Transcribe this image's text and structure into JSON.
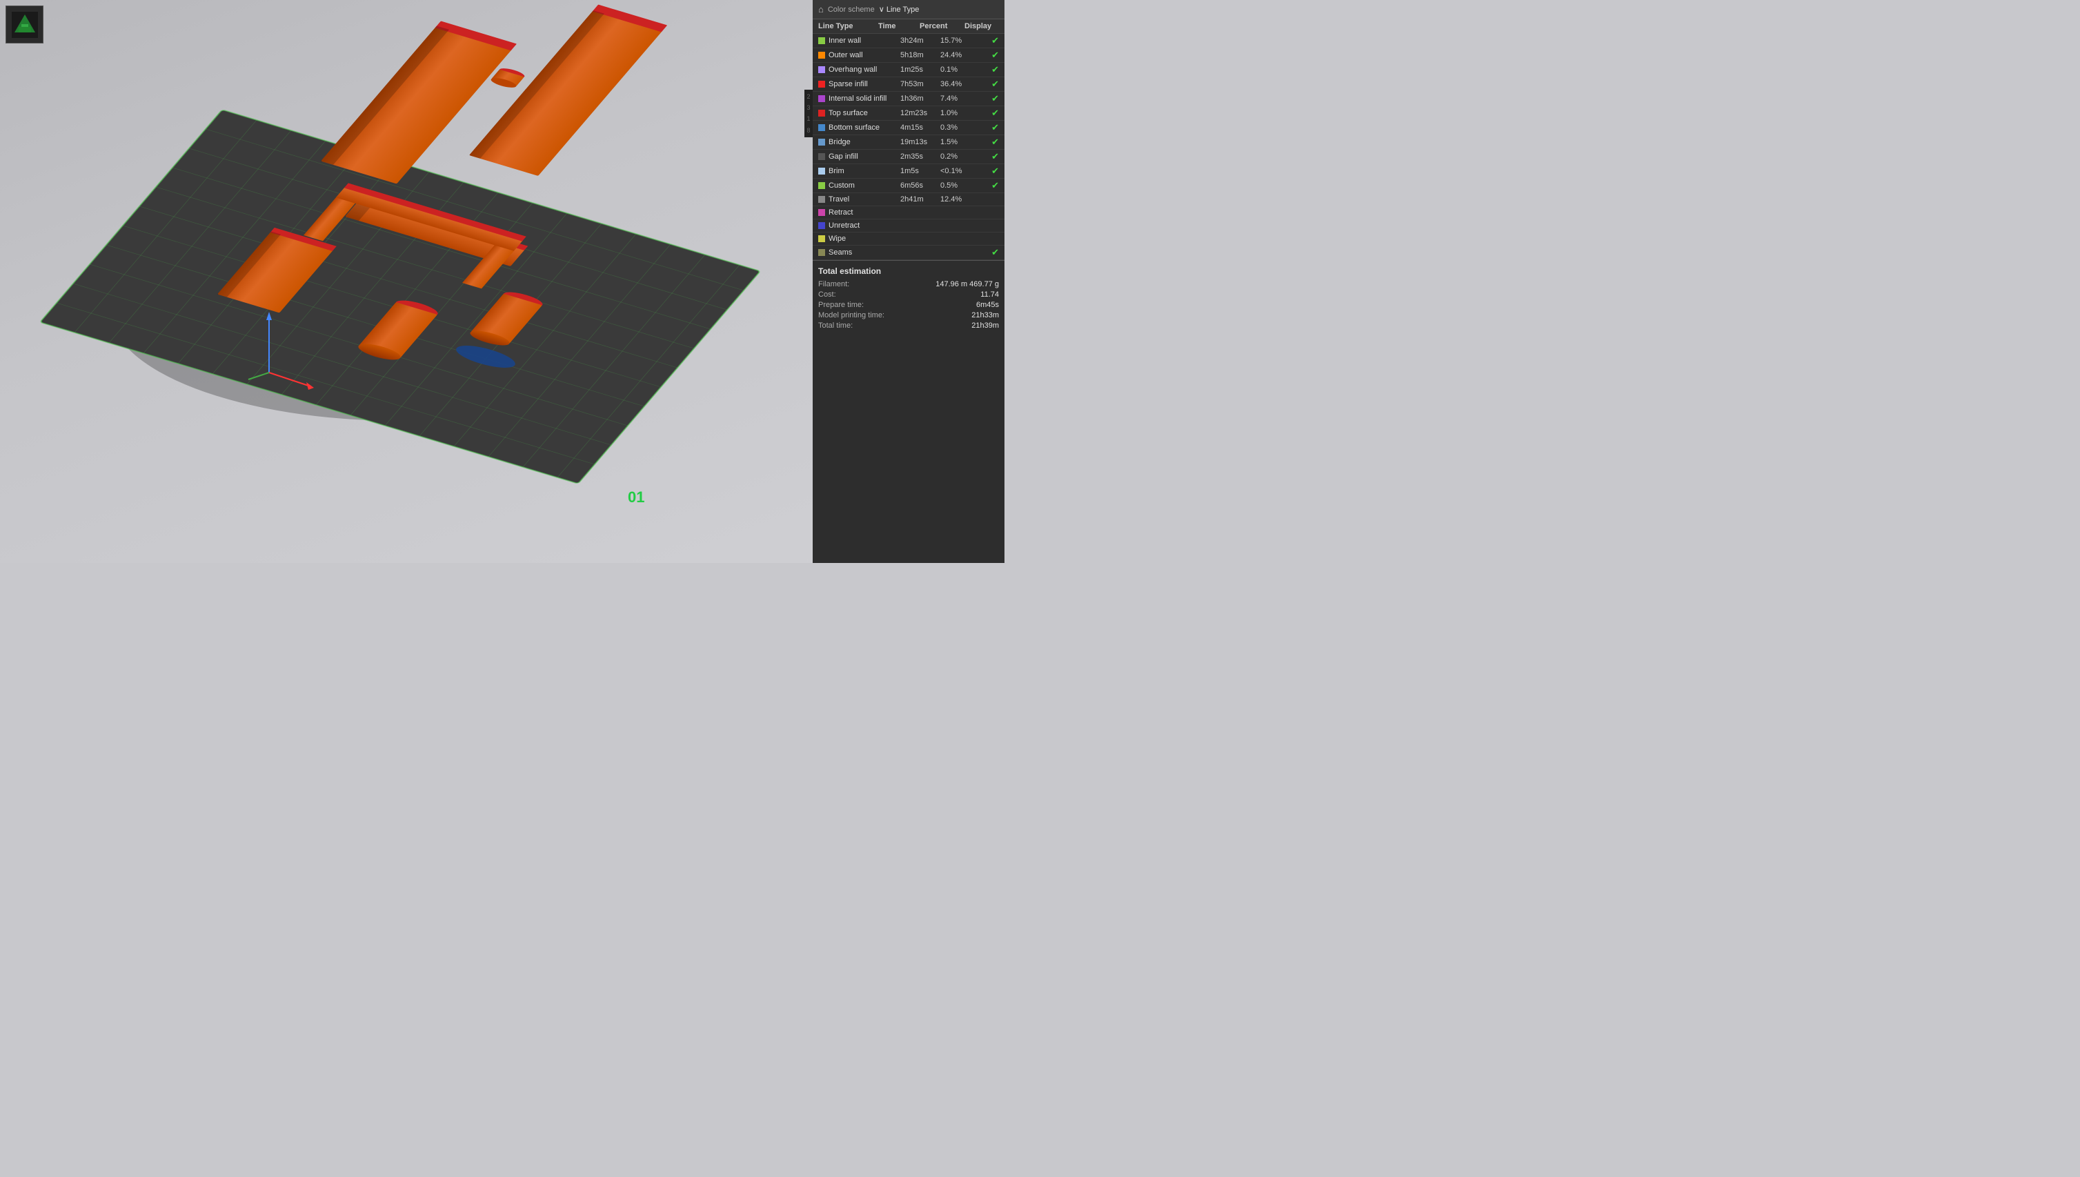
{
  "viewport": {
    "background": "#c0c0c4"
  },
  "thumbnail": {
    "alt": "3D model thumbnail"
  },
  "label_01": "01",
  "panel": {
    "header": {
      "icon": "⌂",
      "color_scheme_label": "Color scheme",
      "line_type_label": "∨ Line Type"
    },
    "columns": {
      "line_type": "Line Type",
      "time": "Time",
      "percent": "Percent",
      "display": "Display"
    },
    "items": [
      {
        "name": "Inner wall",
        "color": "#88cc44",
        "time": "3h24m",
        "pct": "15.7%",
        "checked": true
      },
      {
        "name": "Outer wall",
        "color": "#ff8800",
        "time": "5h18m",
        "pct": "24.4%",
        "checked": true
      },
      {
        "name": "Overhang wall",
        "color": "#aa88ff",
        "time": "1m25s",
        "pct": "0.1%",
        "checked": true
      },
      {
        "name": "Sparse infill",
        "color": "#ee2222",
        "time": "7h53m",
        "pct": "36.4%",
        "checked": true
      },
      {
        "name": "Internal solid infill",
        "color": "#aa44cc",
        "time": "1h36m",
        "pct": "7.4%",
        "checked": true
      },
      {
        "name": "Top surface",
        "color": "#dd2222",
        "time": "12m23s",
        "pct": "1.0%",
        "checked": true
      },
      {
        "name": "Bottom surface",
        "color": "#4488cc",
        "time": "4m15s",
        "pct": "0.3%",
        "checked": true
      },
      {
        "name": "Bridge",
        "color": "#6699cc",
        "time": "19m13s",
        "pct": "1.5%",
        "checked": true
      },
      {
        "name": "Gap infill",
        "color": "#555555",
        "time": "2m35s",
        "pct": "0.2%",
        "checked": true
      },
      {
        "name": "Brim",
        "color": "#aaccee",
        "time": "1m5s",
        "pct": "<0.1%",
        "checked": true
      },
      {
        "name": "Custom",
        "color": "#88cc44",
        "time": "6m56s",
        "pct": "0.5%",
        "checked": true
      },
      {
        "name": "Travel",
        "color": "#888888",
        "time": "2h41m",
        "pct": "12.4%",
        "checked": false
      },
      {
        "name": "Retract",
        "color": "#cc44aa",
        "time": "",
        "pct": "",
        "checked": false
      },
      {
        "name": "Unretract",
        "color": "#4444cc",
        "time": "",
        "pct": "",
        "checked": false
      },
      {
        "name": "Wipe",
        "color": "#cccc44",
        "time": "",
        "pct": "",
        "checked": false
      },
      {
        "name": "Seams",
        "color": "#888855",
        "time": "",
        "pct": "",
        "checked": true
      }
    ],
    "total_estimation": {
      "title": "Total estimation",
      "rows": [
        {
          "label": "Filament:",
          "value": "147.96 m  469.77 g"
        },
        {
          "label": "Cost:",
          "value": "11.74"
        },
        {
          "label": "Prepare time:",
          "value": "6m45s"
        },
        {
          "label": "Model printing time:",
          "value": "21h33m"
        },
        {
          "label": "Total time:",
          "value": "21h39m"
        }
      ]
    }
  },
  "scrollbar": {
    "numbers": [
      "2",
      "3",
      "1",
      "8"
    ]
  }
}
